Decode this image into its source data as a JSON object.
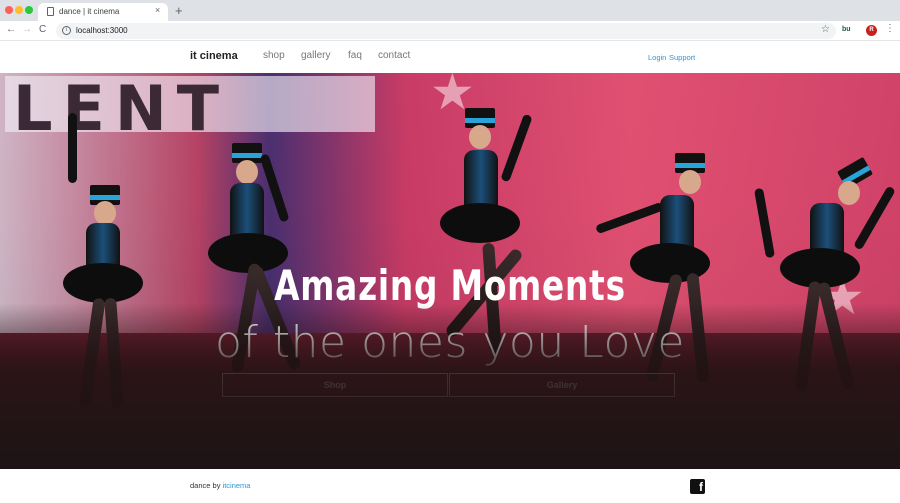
{
  "browser": {
    "tab_title": "dance | it cinema",
    "tab_close": "×",
    "new_tab": "+",
    "url": "localhost:3000",
    "nav": {
      "back": "←",
      "forward": "→",
      "reload": "C"
    },
    "star": "☆",
    "extension": "bu",
    "profile_initial": "R",
    "menu": "⋮",
    "info": "i"
  },
  "site": {
    "brand": "it cinema",
    "nav_links": [
      "shop",
      "gallery",
      "faq",
      "contact"
    ],
    "aux_links": [
      "Login",
      "Support"
    ],
    "accent_color": "#2d97d6"
  },
  "hero": {
    "banner_letters": "LENT",
    "headline": "Amazing Moments",
    "subline": "of the ones you Love",
    "buttons": [
      "Shop",
      "Gallery"
    ]
  },
  "footer": {
    "credit_prefix": "dance by ",
    "credit_link": "itcinema",
    "social_icon": "f"
  }
}
